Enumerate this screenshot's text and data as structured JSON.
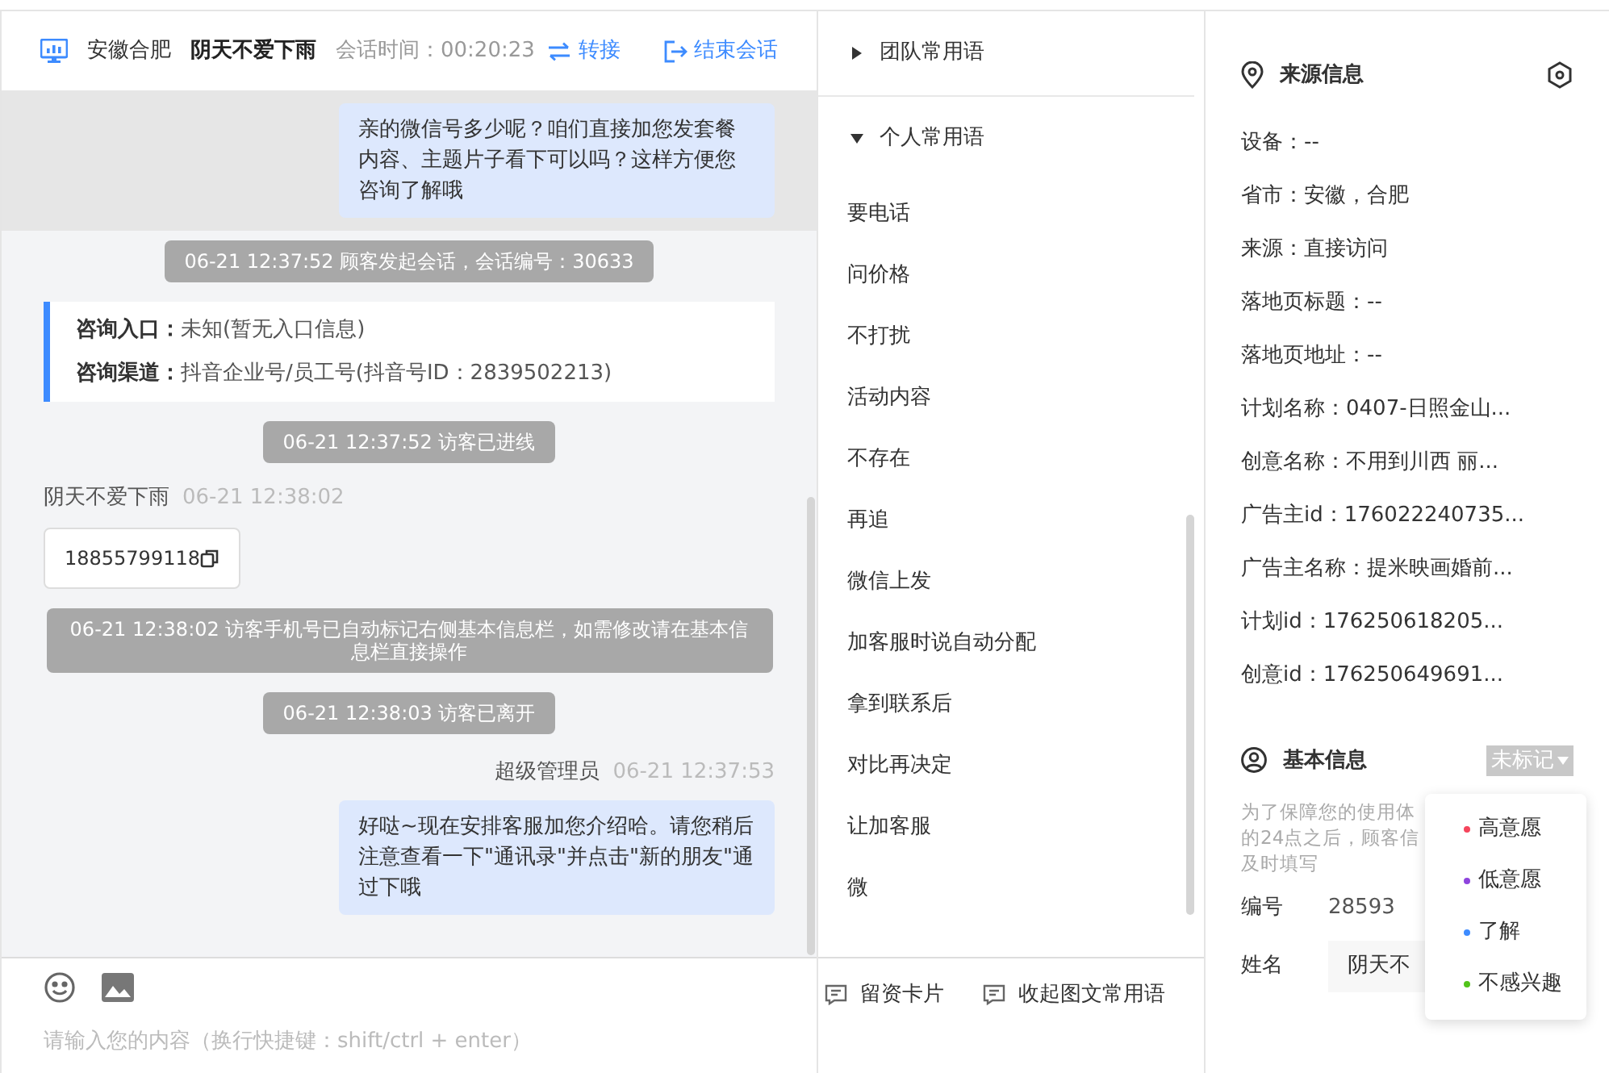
{
  "header": {
    "city": "安徽合肥",
    "visitor": "阴天不爱下雨",
    "duration": "会话时间：00:20:23",
    "transfer": "转接",
    "end": "结束会话"
  },
  "messages": [
    {
      "kind": "agent",
      "text": "亲的微信号多少呢？咱们直接加您发套餐内容、主题片子看下可以吗？这样方便您咨询了解哦",
      "highlighted": true
    },
    {
      "kind": "system",
      "text": "06-21 12:37:52 顾客发起会话，会话编号：30633"
    },
    {
      "kind": "info",
      "rows": [
        {
          "label": "咨询入口：",
          "value": "未知(暂无入口信息)"
        },
        {
          "label": "咨询渠道：",
          "value": "抖音企业号/员工号(抖音号ID：2839502213)"
        }
      ]
    },
    {
      "kind": "system",
      "text": "06-21 12:37:52 访客已进线"
    },
    {
      "kind": "visitor",
      "name": "阴天不爱下雨",
      "time": "06-21 12:38:02",
      "text": "18855799118"
    },
    {
      "kind": "system",
      "text": "06-21 12:38:02 访客手机号已自动标记右侧基本信息栏，如需修改请在基本信息栏直接操作"
    },
    {
      "kind": "system",
      "text": "06-21 12:38:03 访客已离开"
    },
    {
      "kind": "agent",
      "name": "超级管理员",
      "time": "06-21 12:37:53",
      "text": "好哒~现在安排客服加您介绍哈。请您稍后注意查看一下\"通讯录\"并点击\"新的朋友\"通过下哦",
      "highlighted": false
    }
  ],
  "composer": {
    "placeholder": "请输入您的内容（换行快捷键：shift/ctrl + enter）"
  },
  "quick_replies": {
    "groups": [
      {
        "label": "团队常用语",
        "expanded": false
      },
      {
        "label": "个人常用语",
        "expanded": true,
        "items": [
          "要电话",
          "问价格",
          "不打扰",
          "活动内容",
          "不存在",
          "再追",
          "微信上发",
          "加客服时说自动分配",
          "拿到联系后",
          "对比再决定",
          "让加客服",
          "微"
        ]
      }
    ],
    "actions": [
      "留资卡片",
      "收起图文常用语"
    ]
  },
  "source_info": {
    "title": "来源信息",
    "fields": [
      "设备：--",
      "省市：安徽，合肥",
      "来源：直接访问",
      "落地页标题：--",
      "落地页地址：--",
      "计划名称：0407-日照金山...",
      "创意名称：不用到川西 丽...",
      "广告主id：176022240735...",
      "广告主名称：提米映画婚前...",
      "计划id：176250618205...",
      "创意id：176250649691..."
    ]
  },
  "basic_info": {
    "title": "基本信息",
    "tag": "未标记",
    "notice": [
      "为了保障您的使用体",
      "的24点之后，顾客信",
      "及时填写"
    ],
    "fields": [
      {
        "kind": "text",
        "label": "编号",
        "value": "28593"
      },
      {
        "kind": "input",
        "label": "姓名",
        "value": "阴天不"
      }
    ],
    "tag_menu": [
      {
        "label": "高意愿",
        "color": "#f5455c"
      },
      {
        "label": "低意愿",
        "color": "#8e44dd"
      },
      {
        "label": "了解",
        "color": "#3d8bff"
      },
      {
        "label": "不感兴趣",
        "color": "#52c41a"
      }
    ]
  }
}
